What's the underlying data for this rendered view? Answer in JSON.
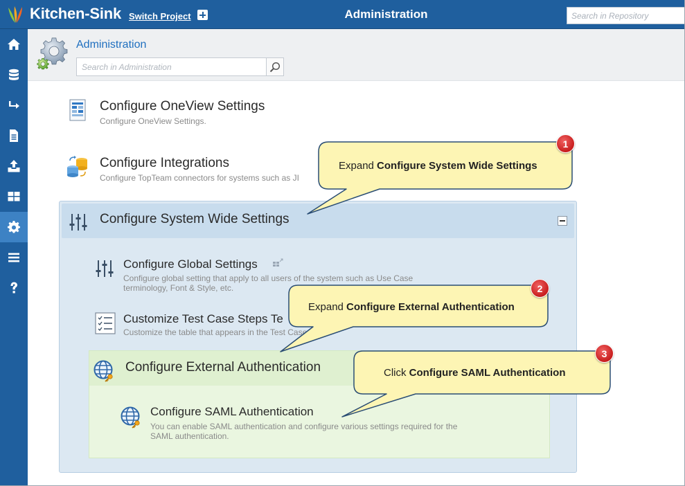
{
  "topbar": {
    "app_title": "Kitchen-Sink",
    "switch_project": "Switch Project",
    "center_title": "Administration",
    "search_placeholder": "Search in Repository"
  },
  "sidebar": {
    "items": [
      {
        "icon": "home-icon"
      },
      {
        "icon": "database-icon"
      },
      {
        "icon": "arrow-right-icon"
      },
      {
        "icon": "document-icon"
      },
      {
        "icon": "upload-icon"
      },
      {
        "icon": "dashboard-icon"
      },
      {
        "icon": "gear-icon",
        "active": true
      },
      {
        "icon": "menu-icon"
      },
      {
        "icon": "help-icon"
      }
    ]
  },
  "header": {
    "title": "Administration",
    "search_placeholder": "Search in Administration"
  },
  "items": {
    "oneview": {
      "title": "Configure OneView Settings",
      "desc": "Configure OneView Settings."
    },
    "integrations": {
      "title": "Configure Integrations",
      "desc": "Configure TopTeam connectors for systems such as JI"
    },
    "system_wide": {
      "title": "Configure System Wide Settings"
    },
    "global": {
      "title": "Configure Global Settings",
      "desc_line1": "Configure global setting that apply to all users of the system such as Use Case",
      "desc_line2": "terminology, Font & Style, etc."
    },
    "test_case": {
      "title": "Customize Test Case Steps Te",
      "desc": "Customize the table that appears in the Test Case S"
    },
    "ext_auth": {
      "title": "Configure External Authentication"
    },
    "saml": {
      "title": "Configure SAML Authentication",
      "desc_line1": "You can enable SAML authentication and configure various settings required for the",
      "desc_line2": "SAML authentication."
    }
  },
  "callouts": [
    {
      "badge": "1",
      "prefix": "Expand ",
      "bold": "Configure System Wide Settings"
    },
    {
      "badge": "2",
      "prefix": "Expand ",
      "bold": "Configure External Authentication"
    },
    {
      "badge": "3",
      "prefix": "Click ",
      "bold": "Configure SAML Authentication"
    }
  ],
  "colors": {
    "brand_blue": "#1f5f9e",
    "active_blue": "#3d82c4",
    "callout_fill": "#fdf5b4",
    "badge_red": "#d62828"
  }
}
